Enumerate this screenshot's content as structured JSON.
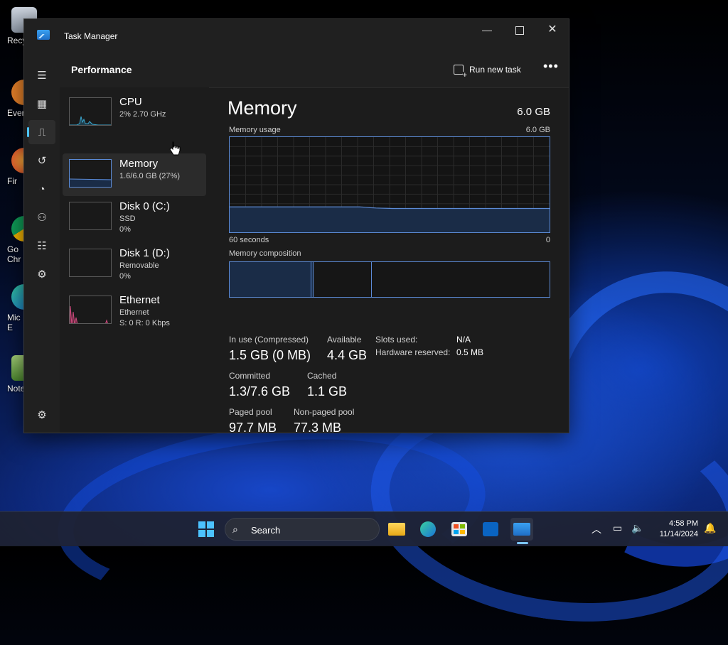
{
  "desktop": {
    "icons": [
      {
        "label": "Recy"
      },
      {
        "label": "Ever"
      },
      {
        "label": "Fir"
      },
      {
        "label": "Go",
        "label2": "Chr"
      },
      {
        "label": "Mic",
        "label2": "E"
      },
      {
        "label": "Note"
      }
    ]
  },
  "window": {
    "title": "Task Manager",
    "controls": {
      "minimize": "—",
      "close": "✕"
    }
  },
  "nav": {
    "items": [
      {
        "name": "hamburger-icon",
        "glyph": "☰"
      },
      {
        "name": "processes-icon",
        "glyph": "▦"
      },
      {
        "name": "performance-icon",
        "glyph": "⎍",
        "active": true
      },
      {
        "name": "app-history-icon",
        "glyph": "↺"
      },
      {
        "name": "startup-apps-icon",
        "glyph": "◔"
      },
      {
        "name": "users-icon",
        "glyph": "⚇"
      },
      {
        "name": "details-icon",
        "glyph": "☷"
      },
      {
        "name": "services-icon",
        "glyph": "⚙"
      },
      {
        "name": "settings-icon",
        "glyph": "⚙"
      }
    ]
  },
  "header": {
    "title": "Performance",
    "run_new_task": "Run new task",
    "more": "•••"
  },
  "perf_list": [
    {
      "title": "CPU",
      "sub1": "2% 2.70 GHz",
      "sub2": ""
    },
    {
      "title": "Memory",
      "sub1": "1.6/6.0 GB (27%)",
      "sub2": "",
      "selected": true
    },
    {
      "title": "Disk 0 (C:)",
      "sub1": "SSD",
      "sub2": "0%"
    },
    {
      "title": "Disk 1 (D:)",
      "sub1": "Removable",
      "sub2": "0%"
    },
    {
      "title": "Ethernet",
      "sub1": "Ethernet",
      "sub2": "S: 0 R: 0 Kbps"
    }
  ],
  "detail": {
    "title": "Memory",
    "total": "6.0 GB",
    "usage_label": "Memory usage",
    "usage_max": "6.0 GB",
    "axis_left": "60 seconds",
    "axis_right": "0",
    "composition_label": "Memory composition",
    "stats": {
      "in_use_label": "In use (Compressed)",
      "in_use_value": "1.5 GB (0 MB)",
      "available_label": "Available",
      "available_value": "4.4 GB",
      "committed_label": "Committed",
      "committed_value": "1.3/7.6 GB",
      "cached_label": "Cached",
      "cached_value": "1.1 GB",
      "paged_label": "Paged pool",
      "paged_value": "97.7 MB",
      "nonpaged_label": "Non-paged pool",
      "nonpaged_value": "77.3 MB",
      "slots_label": "Slots used:",
      "slots_value": "N/A",
      "hw_reserved_label": "Hardware reserved:",
      "hw_reserved_value": "0.5 MB"
    },
    "usage_series_gb": [
      1.6,
      1.6,
      1.6,
      1.6,
      1.6,
      1.6,
      1.6,
      1.6,
      1.6,
      1.6,
      1.6,
      1.6,
      1.6,
      1.6,
      1.6,
      1.6,
      1.6,
      1.6,
      1.6,
      1.6,
      1.6,
      1.6,
      1.6,
      1.6,
      1.6,
      1.58,
      1.55,
      1.53,
      1.52,
      1.51,
      1.5,
      1.5,
      1.5,
      1.5,
      1.5,
      1.5,
      1.5,
      1.5,
      1.5,
      1.5,
      1.5,
      1.5,
      1.5,
      1.5,
      1.5,
      1.5,
      1.5,
      1.5,
      1.5,
      1.5,
      1.5,
      1.5,
      1.5,
      1.5,
      1.5,
      1.5,
      1.5,
      1.5,
      1.5,
      1.5
    ]
  },
  "taskbar": {
    "search_placeholder": "Search",
    "time": "4:58 PM",
    "date": "11/14/2024"
  },
  "colors": {
    "accent": "#4cc2ff",
    "graph_line": "#5c8bd6",
    "graph_fill": "#1a2c47"
  }
}
